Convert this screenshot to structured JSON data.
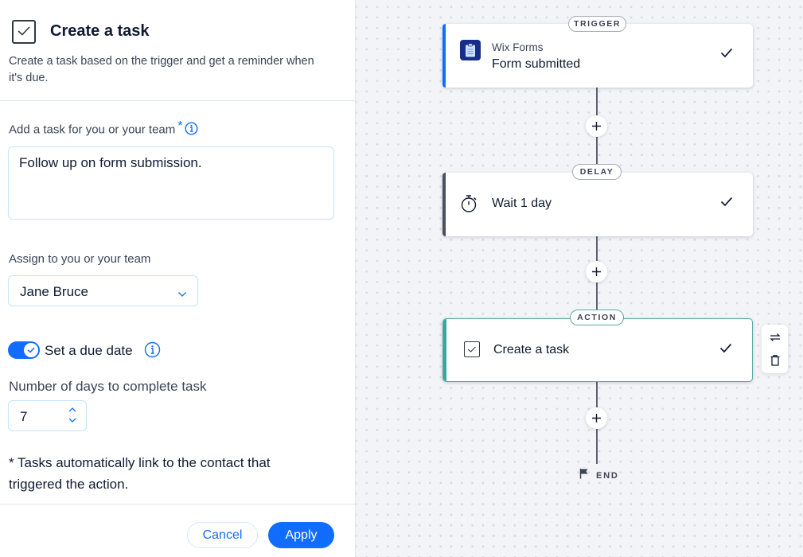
{
  "panel": {
    "icon": "task-checkbox-icon",
    "title": "Create a task",
    "description": "Create a task based on the trigger and get a reminder when it's due.",
    "task_field": {
      "label": "Add a task for you or your team",
      "required_marker": "*",
      "value": "Follow up on form submission."
    },
    "assign_field": {
      "label": "Assign to you or your team",
      "selected": "Jane Bruce"
    },
    "due_date_toggle": {
      "label": "Set a due date",
      "checked": true
    },
    "days_field": {
      "label": "Number of days to complete task",
      "value": "7"
    },
    "note": "* Tasks automatically link to the contact that triggered the action.",
    "footer": {
      "cancel_label": "Cancel",
      "apply_label": "Apply"
    }
  },
  "canvas": {
    "accent_color": "#116dff",
    "nodes": [
      {
        "type_label": "TRIGGER",
        "app": "Wix Forms",
        "title": "Form submitted",
        "icon": "clipboard-icon",
        "bar_color": "#116dff",
        "status": "complete"
      },
      {
        "type_label": "DELAY",
        "title": "Wait 1 day",
        "icon": "stopwatch-icon",
        "bar_color": "#4a5060",
        "status": "complete"
      },
      {
        "type_label": "ACTION",
        "title": "Create a task",
        "icon": "task-checkbox-icon",
        "bar_color": "#3fa3a0",
        "status": "complete",
        "selected": true
      }
    ],
    "side_actions": [
      "replace-icon",
      "delete-icon"
    ],
    "end_label": "END"
  }
}
